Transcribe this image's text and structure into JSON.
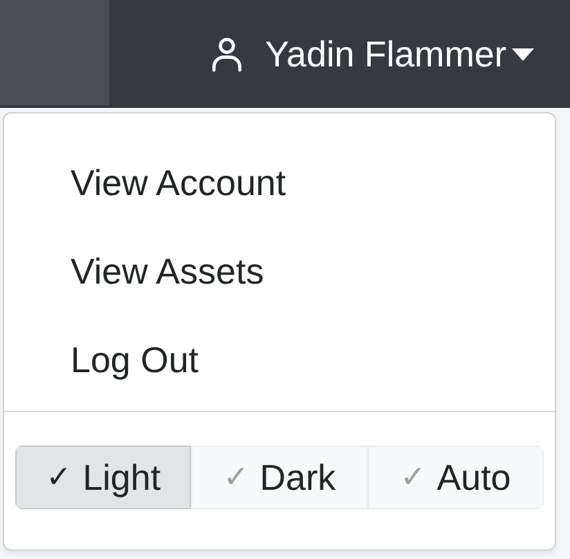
{
  "navbar": {
    "user": {
      "name": "Yadin Flammer"
    }
  },
  "menu": {
    "items": [
      {
        "label": "View Account"
      },
      {
        "label": "View Assets"
      },
      {
        "label": "Log Out"
      }
    ],
    "themes": [
      {
        "check": "✓",
        "label": "Light",
        "selected": true
      },
      {
        "check": "✓",
        "label": "Dark",
        "selected": false
      },
      {
        "check": "✓",
        "label": "Auto",
        "selected": false
      }
    ]
  }
}
